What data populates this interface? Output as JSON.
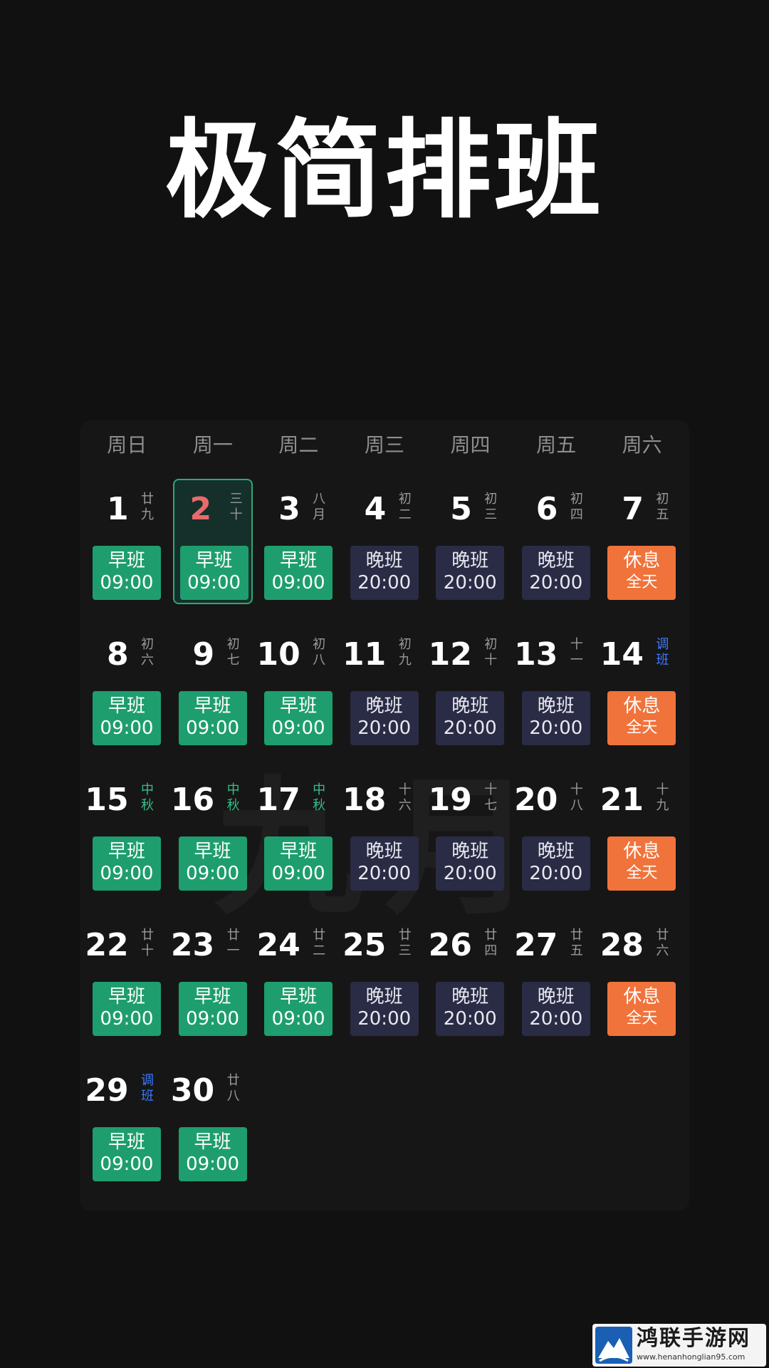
{
  "headline": "极简排班",
  "month_watermark": "九月",
  "weekdays": [
    "周日",
    "周一",
    "周二",
    "周三",
    "周四",
    "周五",
    "周六"
  ],
  "days": [
    {
      "d": "1",
      "lunar": "廿九",
      "lunar_type": "normal",
      "shift": "早班",
      "time": "09:00",
      "type": "early"
    },
    {
      "d": "2",
      "lunar": "三十",
      "lunar_type": "normal",
      "shift": "早班",
      "time": "09:00",
      "type": "early",
      "today": true
    },
    {
      "d": "3",
      "lunar": "八月",
      "lunar_type": "normal",
      "shift": "早班",
      "time": "09:00",
      "type": "early"
    },
    {
      "d": "4",
      "lunar": "初二",
      "lunar_type": "normal",
      "shift": "晚班",
      "time": "20:00",
      "type": "late"
    },
    {
      "d": "5",
      "lunar": "初三",
      "lunar_type": "normal",
      "shift": "晚班",
      "time": "20:00",
      "type": "late"
    },
    {
      "d": "6",
      "lunar": "初四",
      "lunar_type": "normal",
      "shift": "晚班",
      "time": "20:00",
      "type": "late"
    },
    {
      "d": "7",
      "lunar": "初五",
      "lunar_type": "normal",
      "shift": "休息",
      "time": "全天",
      "type": "rest"
    },
    {
      "d": "8",
      "lunar": "初六",
      "lunar_type": "normal",
      "shift": "早班",
      "time": "09:00",
      "type": "early"
    },
    {
      "d": "9",
      "lunar": "初七",
      "lunar_type": "normal",
      "shift": "早班",
      "time": "09:00",
      "type": "early"
    },
    {
      "d": "10",
      "lunar": "初八",
      "lunar_type": "normal",
      "shift": "早班",
      "time": "09:00",
      "type": "early"
    },
    {
      "d": "11",
      "lunar": "初九",
      "lunar_type": "normal",
      "shift": "晚班",
      "time": "20:00",
      "type": "late"
    },
    {
      "d": "12",
      "lunar": "初十",
      "lunar_type": "normal",
      "shift": "晚班",
      "time": "20:00",
      "type": "late"
    },
    {
      "d": "13",
      "lunar": "十一",
      "lunar_type": "normal",
      "shift": "晚班",
      "time": "20:00",
      "type": "late"
    },
    {
      "d": "14",
      "lunar": "调班",
      "lunar_type": "adjust",
      "shift": "休息",
      "time": "全天",
      "type": "rest"
    },
    {
      "d": "15",
      "lunar": "中秋",
      "lunar_type": "festival",
      "shift": "早班",
      "time": "09:00",
      "type": "early"
    },
    {
      "d": "16",
      "lunar": "中秋",
      "lunar_type": "festival",
      "shift": "早班",
      "time": "09:00",
      "type": "early"
    },
    {
      "d": "17",
      "lunar": "中秋",
      "lunar_type": "festival",
      "shift": "早班",
      "time": "09:00",
      "type": "early"
    },
    {
      "d": "18",
      "lunar": "十六",
      "lunar_type": "normal",
      "shift": "晚班",
      "time": "20:00",
      "type": "late"
    },
    {
      "d": "19",
      "lunar": "十七",
      "lunar_type": "normal",
      "shift": "晚班",
      "time": "20:00",
      "type": "late"
    },
    {
      "d": "20",
      "lunar": "十八",
      "lunar_type": "normal",
      "shift": "晚班",
      "time": "20:00",
      "type": "late"
    },
    {
      "d": "21",
      "lunar": "十九",
      "lunar_type": "normal",
      "shift": "休息",
      "time": "全天",
      "type": "rest"
    },
    {
      "d": "22",
      "lunar": "廿十",
      "lunar_type": "normal",
      "shift": "早班",
      "time": "09:00",
      "type": "early"
    },
    {
      "d": "23",
      "lunar": "廿一",
      "lunar_type": "normal",
      "shift": "早班",
      "time": "09:00",
      "type": "early"
    },
    {
      "d": "24",
      "lunar": "廿二",
      "lunar_type": "normal",
      "shift": "早班",
      "time": "09:00",
      "type": "early"
    },
    {
      "d": "25",
      "lunar": "廿三",
      "lunar_type": "normal",
      "shift": "晚班",
      "time": "20:00",
      "type": "late"
    },
    {
      "d": "26",
      "lunar": "廿四",
      "lunar_type": "normal",
      "shift": "晚班",
      "time": "20:00",
      "type": "late"
    },
    {
      "d": "27",
      "lunar": "廿五",
      "lunar_type": "normal",
      "shift": "晚班",
      "time": "20:00",
      "type": "late"
    },
    {
      "d": "28",
      "lunar": "廿六",
      "lunar_type": "normal",
      "shift": "休息",
      "time": "全天",
      "type": "rest"
    },
    {
      "d": "29",
      "lunar": "调班",
      "lunar_type": "adjust",
      "shift": "早班",
      "time": "09:00",
      "type": "early"
    },
    {
      "d": "30",
      "lunar": "廿八",
      "lunar_type": "normal",
      "shift": "早班",
      "time": "09:00",
      "type": "early"
    }
  ],
  "colors": {
    "early": "#1e9e6e",
    "late": "#2a2b45",
    "rest": "#f0733b",
    "today": "#e96a6a",
    "festival": "#35c08a",
    "adjust": "#3d7bff"
  },
  "site_watermark": {
    "title": "鸿联手游网",
    "url": "www.henanhonglian95.com",
    "logo_icon": "mountain-logo-icon"
  }
}
